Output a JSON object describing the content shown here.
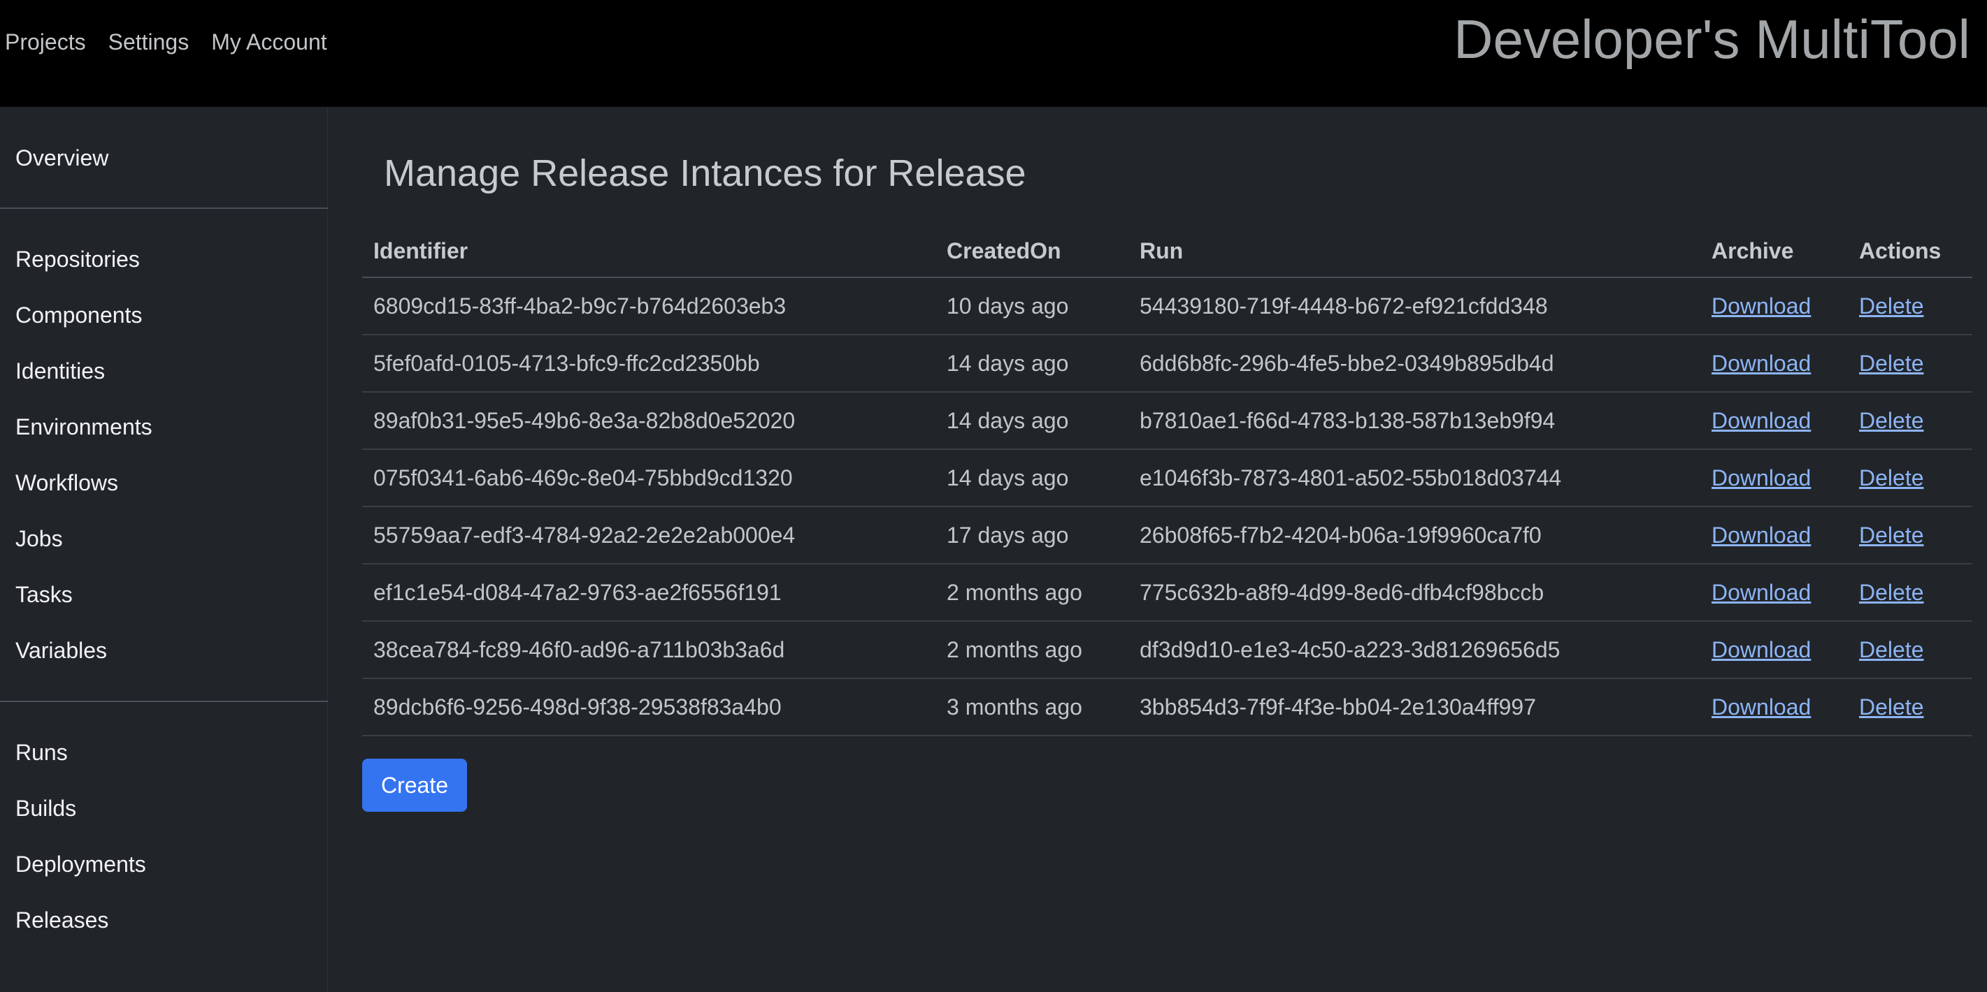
{
  "app": {
    "brand": "Developer's MultiTool"
  },
  "topnav": [
    {
      "label": "Projects"
    },
    {
      "label": "Settings"
    },
    {
      "label": "My Account"
    }
  ],
  "sidebar": {
    "group1": [
      {
        "label": "Overview"
      }
    ],
    "group2": [
      {
        "label": "Repositories"
      },
      {
        "label": "Components"
      },
      {
        "label": "Identities"
      },
      {
        "label": "Environments"
      },
      {
        "label": "Workflows"
      },
      {
        "label": "Jobs"
      },
      {
        "label": "Tasks"
      },
      {
        "label": "Variables"
      }
    ],
    "group3": [
      {
        "label": "Runs"
      },
      {
        "label": "Builds"
      },
      {
        "label": "Deployments"
      },
      {
        "label": "Releases"
      }
    ]
  },
  "main": {
    "title": "Manage Release Intances for Release",
    "table": {
      "headers": [
        "Identifier",
        "CreatedOn",
        "Run",
        "Archive",
        "Actions"
      ],
      "rows": [
        {
          "identifier": "6809cd15-83ff-4ba2-b9c7-b764d2603eb3",
          "created": "10 days ago",
          "run": "54439180-719f-4448-b672-ef921cfdd348",
          "archive": "Download",
          "action": "Delete"
        },
        {
          "identifier": "5fef0afd-0105-4713-bfc9-ffc2cd2350bb",
          "created": "14 days ago",
          "run": "6dd6b8fc-296b-4fe5-bbe2-0349b895db4d",
          "archive": "Download",
          "action": "Delete"
        },
        {
          "identifier": "89af0b31-95e5-49b6-8e3a-82b8d0e52020",
          "created": "14 days ago",
          "run": "b7810ae1-f66d-4783-b138-587b13eb9f94",
          "archive": "Download",
          "action": "Delete"
        },
        {
          "identifier": "075f0341-6ab6-469c-8e04-75bbd9cd1320",
          "created": "14 days ago",
          "run": "e1046f3b-7873-4801-a502-55b018d03744",
          "archive": "Download",
          "action": "Delete"
        },
        {
          "identifier": "55759aa7-edf3-4784-92a2-2e2e2ab000e4",
          "created": "17 days ago",
          "run": "26b08f65-f7b2-4204-b06a-19f9960ca7f0",
          "archive": "Download",
          "action": "Delete"
        },
        {
          "identifier": "ef1c1e54-d084-47a2-9763-ae2f6556f191",
          "created": "2 months ago",
          "run": "775c632b-a8f9-4d99-8ed6-dfb4cf98bccb",
          "archive": "Download",
          "action": "Delete"
        },
        {
          "identifier": "38cea784-fc89-46f0-ad96-a711b03b3a6d",
          "created": "2 months ago",
          "run": "df3d9d10-e1e3-4c50-a223-3d81269656d5",
          "archive": "Download",
          "action": "Delete"
        },
        {
          "identifier": "89dcb6f6-9256-498d-9f38-29538f83a4b0",
          "created": "3 months ago",
          "run": "3bb854d3-7f9f-4f3e-bb04-2e130a4ff997",
          "archive": "Download",
          "action": "Delete"
        }
      ]
    },
    "create_label": "Create"
  },
  "colors": {
    "accent": "#3574f0",
    "link": "#8db4f5",
    "topbar": "#000000",
    "background": "#212529"
  }
}
